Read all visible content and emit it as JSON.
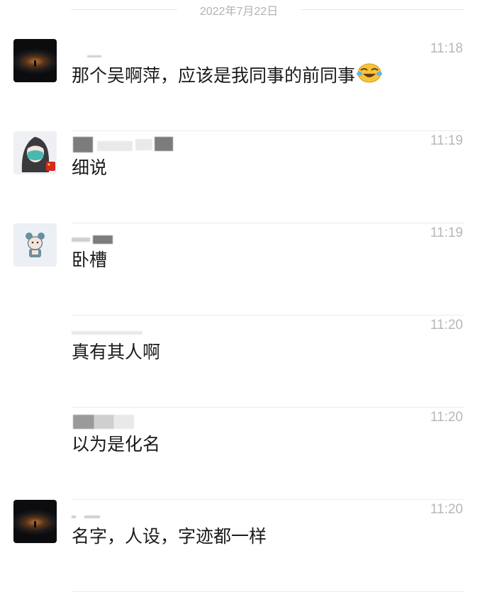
{
  "date_divider": "2022年7月22日",
  "messages": [
    {
      "avatar_icon": "dusk-silhouette-avatar",
      "time": "11:18",
      "text": "那个吴啊萍，应该是我同事的前同事",
      "emoji": "laughing-crying-emoji"
    },
    {
      "avatar_icon": "anime-girl-avatar",
      "time": "11:19",
      "text": "细说"
    },
    {
      "avatar_icon": "cartoon-character-avatar",
      "time": "11:19",
      "text": "卧槽"
    },
    {
      "avatar_icon": "",
      "time": "11:20",
      "text": "真有其人啊"
    },
    {
      "avatar_icon": "",
      "time": "11:20",
      "text": "以为是化名"
    },
    {
      "avatar_icon": "dusk-silhouette-avatar",
      "time": "11:20",
      "text": "名字，人设，字迹都一样"
    }
  ],
  "colors": {
    "background": "#ffffff",
    "message_text": "#1a1a1a",
    "time_text": "#b7b7b7",
    "date_text": "#b3b3b3",
    "separator": "#ececec"
  }
}
